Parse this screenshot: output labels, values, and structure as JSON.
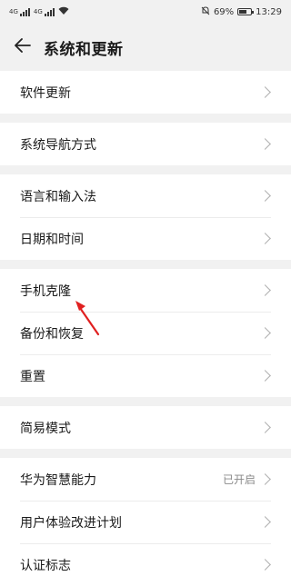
{
  "status": {
    "sim1": "4G",
    "sim2": "4G",
    "battery": "69%",
    "battery_level": 0.69,
    "time": "13:29"
  },
  "header": {
    "title": "系统和更新"
  },
  "groups": [
    {
      "items": [
        {
          "label": "软件更新"
        }
      ]
    },
    {
      "items": [
        {
          "label": "系统导航方式"
        }
      ]
    },
    {
      "items": [
        {
          "label": "语言和输入法"
        },
        {
          "label": "日期和时间"
        }
      ]
    },
    {
      "items": [
        {
          "label": "手机克隆"
        },
        {
          "label": "备份和恢复"
        },
        {
          "label": "重置"
        }
      ]
    },
    {
      "items": [
        {
          "label": "简易模式"
        }
      ]
    },
    {
      "items": [
        {
          "label": "华为智慧能力",
          "value": "已开启"
        },
        {
          "label": "用户体验改进计划"
        },
        {
          "label": "认证标志"
        }
      ]
    }
  ],
  "colors": {
    "background": "#f1f1f1",
    "annotation_arrow": "#e02020"
  },
  "icons": [
    "signal-icon",
    "wifi-icon",
    "mute-icon",
    "battery-icon",
    "back-arrow-icon",
    "chevron-right-icon"
  ]
}
